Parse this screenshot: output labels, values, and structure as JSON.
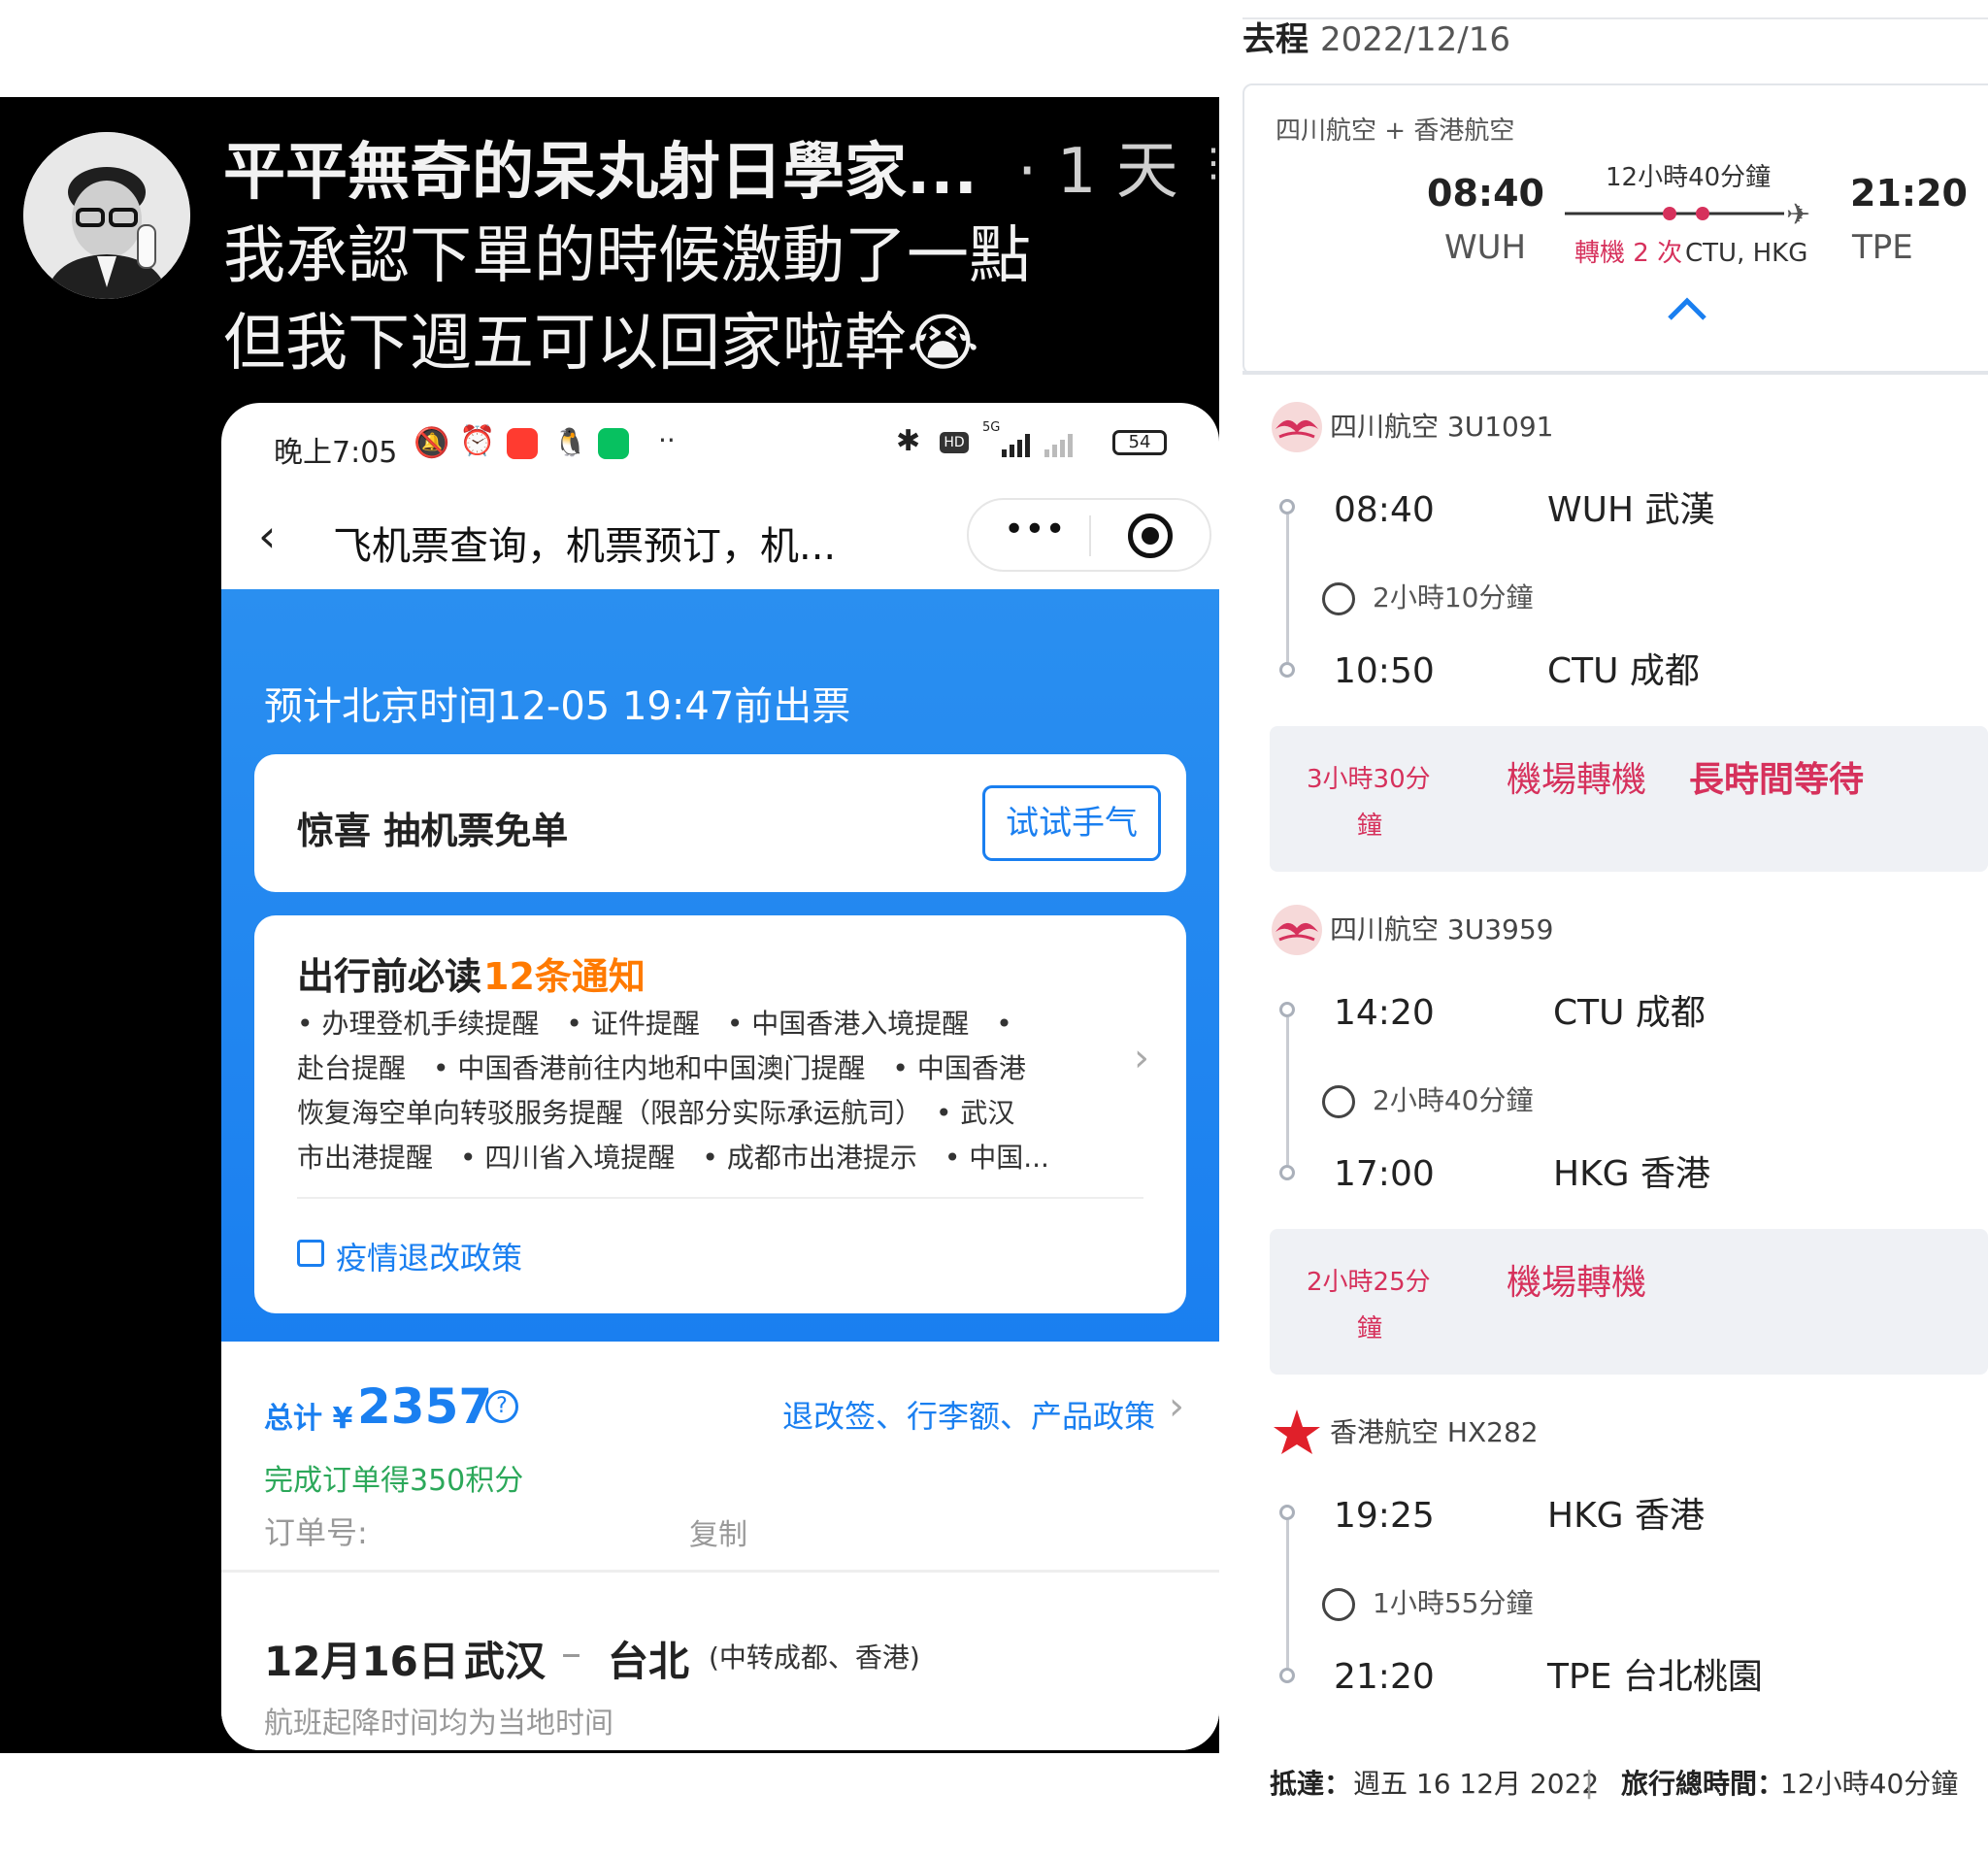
{
  "post": {
    "author": "平平無奇的呆丸射日學家...",
    "time": "· 1 天",
    "more": "⋮",
    "line1": "我承認下單的時候激動了一點",
    "line2": "但我下週五可以回家啦幹",
    "emoji": "😭"
  },
  "phone": {
    "status": {
      "time": "晚上7:05",
      "net": "5G",
      "battery": "54"
    },
    "title": "飞机票查询，机票预订，机...",
    "issue_time": "预计北京时间12-05 19:47前出票",
    "lottery": {
      "title": "惊喜 抽机票免单",
      "button": "试试手气"
    },
    "notice": {
      "title": "出行前必读",
      "count": "12条通知",
      "line1": "• 办理登机手续提醒　• 证件提醒　• 中国香港入境提醒　•",
      "line2": "赴台提醒　• 中国香港前往内地和中国澳门提醒　• 中国香港",
      "line3": "恢复海空单向转驳服务提醒（限部分实际承运航司）　• 武汉",
      "line4": "市出港提醒　• 四川省入境提醒　• 成都市出港提示　• 中国...",
      "policy": "疫情退改政策"
    },
    "price": {
      "label": "总计 ¥",
      "amount": "2357",
      "policy_link": "退改签、行李额、产品政策",
      "points": "完成订单得350积分",
      "order_label": "订单号:",
      "copy": "复制"
    },
    "route": {
      "date": "12月16日",
      "from": "武汉",
      "dash": "–",
      "to": "台北",
      "via": "(中转成都、香港)",
      "note": "航班起降时间均为当地时间"
    }
  },
  "itinerary": {
    "header_label": "去程",
    "header_date": "2022/12/16",
    "summary": {
      "airlines": "四川航空 + 香港航空",
      "dep_time": "08:40",
      "dep_code": "WUH",
      "duration": "12小時40分鐘",
      "stops": "轉機 2 次",
      "stops_via": "CTU, HKG",
      "arr_time": "21:20",
      "arr_code": "TPE"
    },
    "segments": [
      {
        "airline": "四川航空 3U1091",
        "dep_time": "08:40",
        "dep_place": "WUH 武漢",
        "duration": "2小時10分鐘",
        "arr_time": "10:50",
        "arr_place": "CTU 成都"
      },
      {
        "airline": "四川航空 3U3959",
        "dep_time": "14:20",
        "dep_place": "CTU 成都",
        "duration": "2小時40分鐘",
        "arr_time": "17:00",
        "arr_place": "HKG 香港"
      },
      {
        "airline": "香港航空 HX282",
        "dep_time": "19:25",
        "dep_place": "HKG 香港",
        "duration": "1小時55分鐘",
        "arr_time": "21:20",
        "arr_place": "TPE 台北桃園"
      }
    ],
    "layovers": [
      {
        "time": "3小時30分",
        "time2": "鐘",
        "type": "機場轉機",
        "warning": "長時間等待"
      },
      {
        "time": "2小時25分",
        "time2": "鐘",
        "type": "機場轉機"
      }
    ],
    "footer": {
      "arrive_label": "抵達：",
      "arrive_value": "週五 16 12月 2022",
      "sep": "|",
      "total_label": "旅行總時間：",
      "total_value": "12小時40分鐘"
    }
  },
  "colors": {
    "accent_blue": "#1a7ff0",
    "orange": "#ff7a00",
    "red_alert": "#d6315c",
    "hk_red": "#e0202a"
  }
}
